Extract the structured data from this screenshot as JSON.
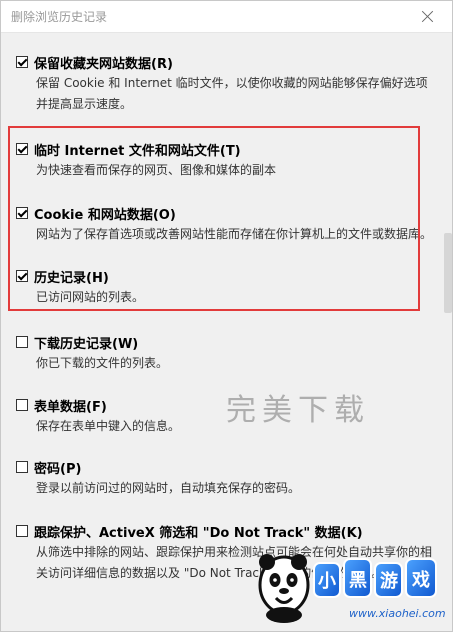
{
  "dialog": {
    "title": "删除浏览历史记录"
  },
  "options": [
    {
      "label": "保留收藏夹网站数据(R)",
      "checked": true,
      "description": "保留 Cookie 和 Internet 临时文件，以使你收藏的网站能够保存偏好选项并提高显示速度。"
    },
    {
      "label": "临时 Internet 文件和网站文件(T)",
      "checked": true,
      "description": "为快速查看而保存的网页、图像和媒体的副本"
    },
    {
      "label": "Cookie 和网站数据(O)",
      "checked": true,
      "description": "网站为了保存首选项或改善网站性能而存储在你计算机上的文件或数据库。"
    },
    {
      "label": "历史记录(H)",
      "checked": true,
      "description": "已访问网站的列表。"
    },
    {
      "label": "下载历史记录(W)",
      "checked": false,
      "description": "你已下载的文件的列表。"
    },
    {
      "label": "表单数据(F)",
      "checked": false,
      "description": "保存在表单中键入的信息。"
    },
    {
      "label": "密码(P)",
      "checked": false,
      "description": "登录以前访问过的网站时，自动填充保存的密码。"
    },
    {
      "label": "跟踪保护、ActiveX 筛选和 \"Do Not Track\" 数据(K)",
      "checked": false,
      "description": "从筛选中排除的网站、跟踪保护用来检测站点可能会在何处自动共享你的相关访问详细信息的数据以及 \"Do Not Track\" 请求的例外的列表。"
    }
  ],
  "watermark": {
    "text": "完美下载"
  },
  "logo": {
    "text": "小黑游戏",
    "url": "www.xiaohei.com"
  },
  "colors": {
    "highlight_border": "#e23b3b",
    "background": "#f0f0f0",
    "logo_blue": "#1e62c9"
  }
}
